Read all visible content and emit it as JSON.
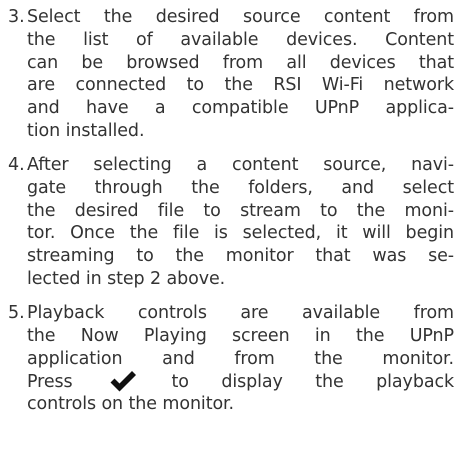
{
  "steps": [
    {
      "number": "3.",
      "lines": [
        "Select the desired source content from",
        "the list of available devices. Content",
        "can be browsed from all devices that",
        "are connected to the RSI Wi-Fi network",
        "and have a compatible UPnP applica-",
        "tion installed."
      ]
    },
    {
      "number": "4.",
      "lines": [
        "After selecting a content source, navi-",
        "gate through the folders, and select",
        "the desired file to stream to the moni-",
        "tor. Once the file is selected, it will begin",
        "streaming to the monitor that was se-",
        "lected in step 2 above."
      ]
    },
    {
      "number": "5.",
      "lines": [
        "Playback controls are available from",
        "the Now Playing screen in the UPnP",
        "application and from the monitor."
      ],
      "press_before": "Press",
      "press_icon": "checkmark-icon",
      "press_after": "to display the playback",
      "final_line": "controls on the monitor."
    }
  ],
  "colors": {
    "text": "#333333",
    "icon": "#111111"
  }
}
